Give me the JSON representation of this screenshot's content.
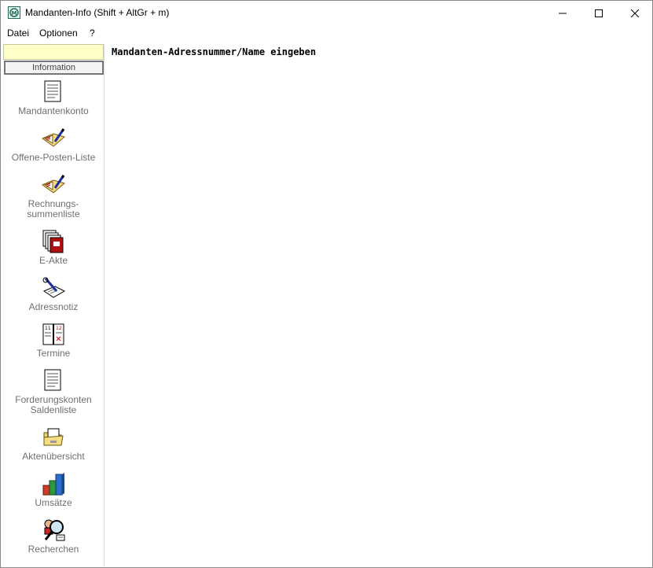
{
  "window": {
    "title": "Mandanten-Info (Shift + AltGr + m)",
    "icon": "mandanten-app-icon"
  },
  "menu": {
    "items": [
      "Datei",
      "Optionen",
      "?"
    ]
  },
  "sidebar": {
    "search_value": "",
    "section_label": "Information",
    "items": [
      {
        "label": "Mandantenkonto",
        "icon": "document-page-icon"
      },
      {
        "label": "Offene-Posten-Liste",
        "icon": "ledger-pen-icon"
      },
      {
        "label": "Rechnungs-\nsummenliste",
        "icon": "ledger-pen-icon"
      },
      {
        "label": "E-Akte",
        "icon": "stacked-files-icon"
      },
      {
        "label": "Adressnotiz",
        "icon": "note-pen-icon"
      },
      {
        "label": "Termine",
        "icon": "calendar-book-icon"
      },
      {
        "label": "Forderungskonten\nSaldenliste",
        "icon": "document-page-icon"
      },
      {
        "label": "Aktenübersicht",
        "icon": "folder-open-icon"
      },
      {
        "label": "Umsätze",
        "icon": "bar-chart-3d-icon"
      },
      {
        "label": "Recherchen",
        "icon": "search-person-icon"
      }
    ]
  },
  "main": {
    "heading": "Mandanten-Adressnummer/Name eingeben"
  },
  "colors": {
    "search_bg": "#ffffc8",
    "nav_text": "#6f6f6f"
  }
}
